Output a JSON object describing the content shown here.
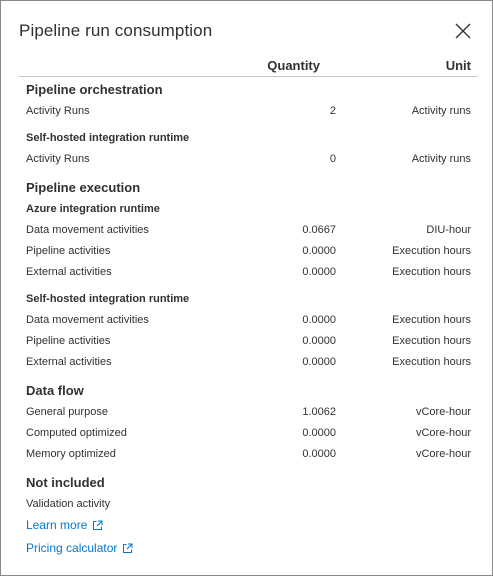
{
  "panel": {
    "title": "Pipeline run consumption",
    "close_icon": "close-icon"
  },
  "columns": {
    "quantity": "Quantity",
    "unit": "Unit"
  },
  "orchestration": {
    "heading": "Pipeline orchestration",
    "activity_runs": {
      "name": "Activity Runs",
      "qty": "2",
      "unit": "Activity runs"
    },
    "self_hosted_heading": "Self-hosted integration runtime",
    "self_hosted_activity_runs": {
      "name": "Activity Runs",
      "qty": "0",
      "unit": "Activity runs"
    }
  },
  "execution": {
    "heading": "Pipeline execution",
    "azure_heading": "Azure integration runtime",
    "azure": [
      {
        "name": "Data movement activities",
        "qty": "0.0667",
        "unit": "DIU-hour"
      },
      {
        "name": "Pipeline activities",
        "qty": "0.0000",
        "unit": "Execution hours"
      },
      {
        "name": "External activities",
        "qty": "0.0000",
        "unit": "Execution hours"
      }
    ],
    "self_hosted_heading": "Self-hosted integration runtime",
    "self_hosted": [
      {
        "name": "Data movement activities",
        "qty": "0.0000",
        "unit": "Execution hours"
      },
      {
        "name": "Pipeline activities",
        "qty": "0.0000",
        "unit": "Execution hours"
      },
      {
        "name": "External activities",
        "qty": "0.0000",
        "unit": "Execution hours"
      }
    ]
  },
  "dataflow": {
    "heading": "Data flow",
    "rows": [
      {
        "name": "General purpose",
        "qty": "1.0062",
        "unit": "vCore-hour"
      },
      {
        "name": "Computed optimized",
        "qty": "0.0000",
        "unit": "vCore-hour"
      },
      {
        "name": "Memory optimized",
        "qty": "0.0000",
        "unit": "vCore-hour"
      }
    ]
  },
  "not_included": {
    "heading": "Not included",
    "item": "Validation activity"
  },
  "links": {
    "learn_more": "Learn more",
    "pricing_calculator": "Pricing calculator",
    "link_icon": "external-link-icon"
  },
  "colors": {
    "link": "#0078d4",
    "text": "#323130",
    "border": "#8a8886"
  }
}
